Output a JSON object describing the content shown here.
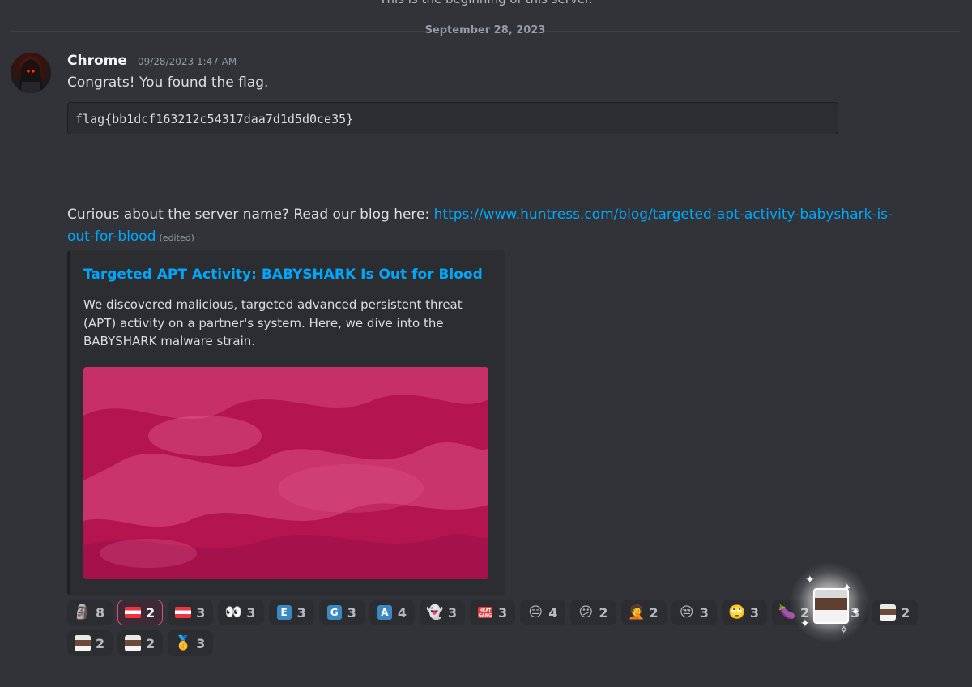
{
  "channel": {
    "beginning_text": "This is the beginning of this server.",
    "date_divider": "September 28, 2023"
  },
  "message": {
    "author": "Chrome",
    "timestamp": "09/28/2023 1:47 AM",
    "line1": "Congrats! You found the flag.",
    "code": "flag{bb1dcf163212c54317daa7d1d5d0ce35}",
    "line2_prefix": "Curious about the server name? Read our blog here: ",
    "link_text": "https://www.huntress.com/blog/targeted-apt-activity-babyshark-is-out-for-blood",
    "edited_label": "(edited)"
  },
  "embed": {
    "title": "Targeted APT Activity: BABYSHARK Is Out for Blood",
    "description": "We discovered malicious, targeted advanced persistent threat (APT) activity on a partner's system. Here, we dive into the BABYSHARK malware strain.",
    "image_color": "#c2185b"
  },
  "reactions": [
    {
      "emoji": "moai-icon",
      "count": "8"
    },
    {
      "emoji": "austria-flag-icon",
      "count": "2",
      "active": true
    },
    {
      "emoji": "austria-flag-icon",
      "count": "3"
    },
    {
      "emoji": "eyes-icon",
      "count": "3"
    },
    {
      "emoji": "regional-e-icon",
      "count": "3"
    },
    {
      "emoji": "regional-g-icon",
      "count": "3"
    },
    {
      "emoji": "regional-a-icon",
      "count": "4"
    },
    {
      "emoji": "ghost-icon",
      "count": "3"
    },
    {
      "emoji": "heat-gang-icon",
      "count": "3"
    },
    {
      "emoji": "expressionless-face-icon",
      "count": "4"
    },
    {
      "emoji": "confused-face-icon",
      "count": "2"
    },
    {
      "emoji": "facepalm-person-icon",
      "count": "2"
    },
    {
      "emoji": "unamused-face-icon",
      "count": "3"
    },
    {
      "emoji": "eye-roll-face-icon",
      "count": "3"
    },
    {
      "emoji": "eggplant-icon",
      "count": "2"
    },
    {
      "emoji": "portrait-sticker-icon",
      "count": "3"
    },
    {
      "emoji": "portrait-sticker-icon",
      "count": "2"
    },
    {
      "emoji": "portrait-sticker-icon",
      "count": "2"
    },
    {
      "emoji": "portrait-sticker-icon",
      "count": "2"
    },
    {
      "emoji": "gold-medal-icon",
      "count": "3"
    }
  ]
}
